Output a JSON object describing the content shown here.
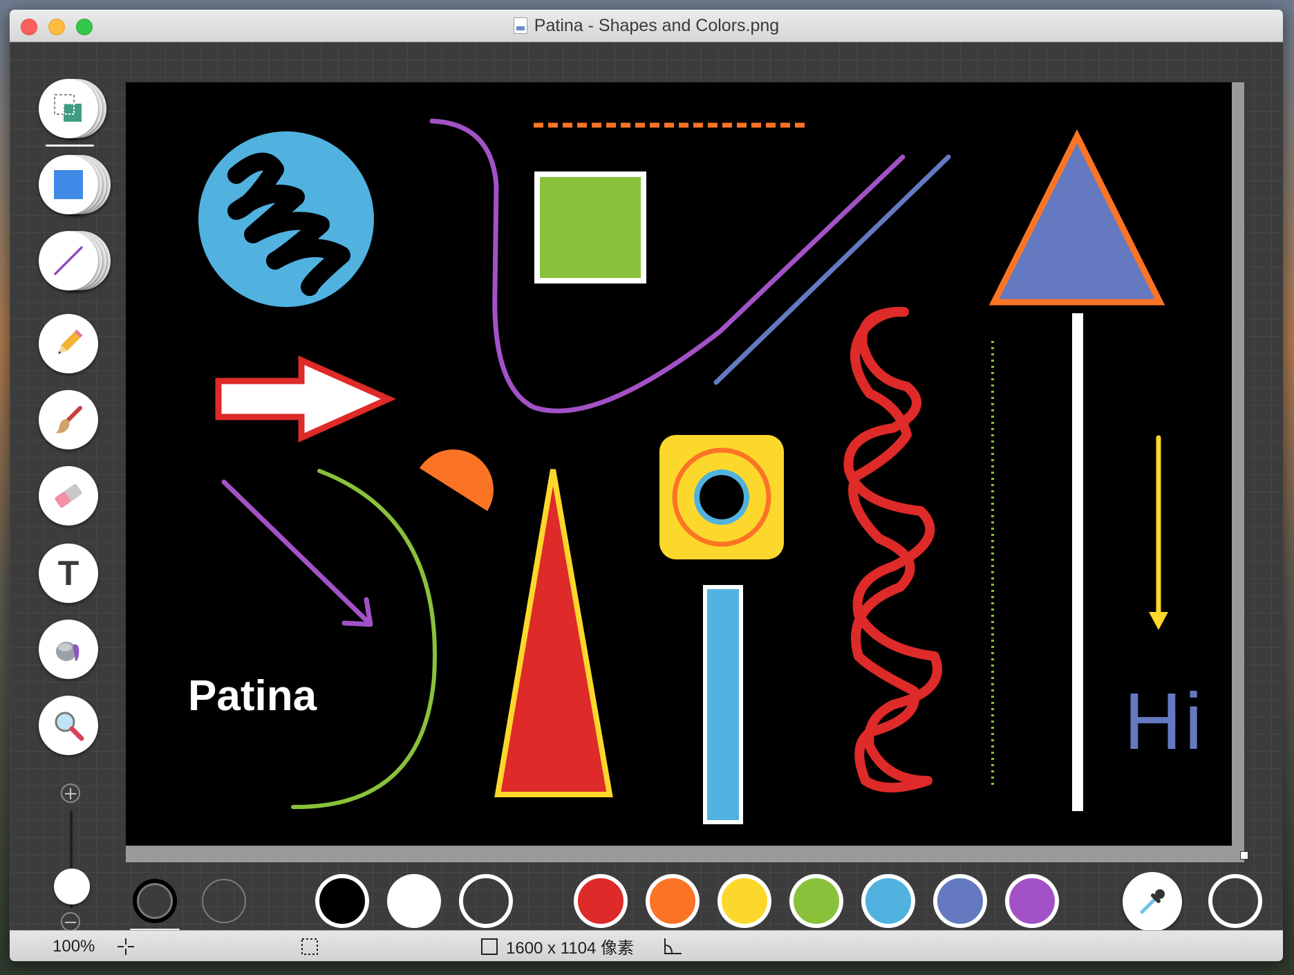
{
  "window": {
    "title": "Patina - Shapes and Colors.png"
  },
  "tools": [
    {
      "name": "selection-tool",
      "icon": "selection-icon"
    },
    {
      "name": "rectangle-tool",
      "icon": "rectangle-icon"
    },
    {
      "name": "line-tool",
      "icon": "line-icon"
    },
    {
      "name": "pencil-tool",
      "icon": "pencil-icon"
    },
    {
      "name": "brush-tool",
      "icon": "brush-icon"
    },
    {
      "name": "eraser-tool",
      "icon": "eraser-icon"
    },
    {
      "name": "text-tool",
      "icon": "text-icon",
      "glyph": "T"
    },
    {
      "name": "fill-tool",
      "icon": "paint-bucket-icon"
    },
    {
      "name": "zoom-tool",
      "icon": "magnifier-icon"
    }
  ],
  "zoom_controls": {
    "plus": "+",
    "minus": "−"
  },
  "canvas_content": {
    "text_label": "Patina",
    "handwritten": "Hi"
  },
  "palette": {
    "colors": [
      "#000000",
      "#ffffff",
      "transparent",
      "#de2a28",
      "#fb7425",
      "#fdd82c",
      "#8ac13b",
      "#51b2df",
      "#6479c0",
      "#a252c6"
    ],
    "eyedropper_icon": "eyedropper-icon"
  },
  "status": {
    "zoom": "100%",
    "size": "1600 x 1104 像素",
    "icons": [
      "crosshair-icon",
      "selection-rect-icon",
      "size-box-icon",
      "angle-icon"
    ]
  }
}
